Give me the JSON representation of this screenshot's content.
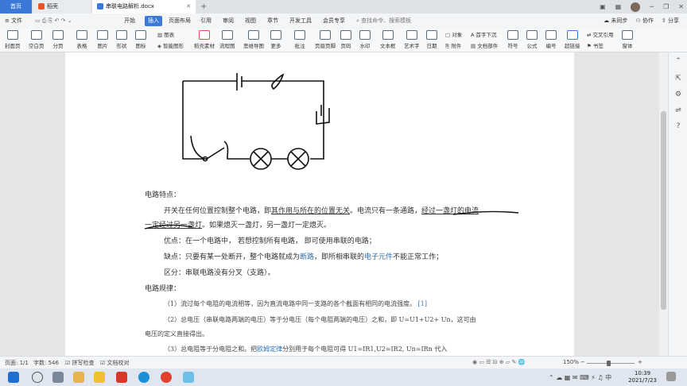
{
  "tabs": {
    "home": "首页",
    "daoke": "稻壳",
    "doc": "串联电路解析.docx",
    "add": "+"
  },
  "menu": {
    "file": "文件",
    "items": [
      "开始",
      "插入",
      "页面布局",
      "引用",
      "审阅",
      "视图",
      "章节",
      "开发工具",
      "会员专享"
    ],
    "search_placeholder": "查找命令、搜索模板",
    "right": [
      "未同步",
      "协作",
      "分享"
    ]
  },
  "ribbon": [
    {
      "label": "封面页",
      "icon": "cover-page-icon"
    },
    {
      "label": "空白页",
      "icon": "blank-page-icon"
    },
    {
      "label": "分页",
      "icon": "page-break-icon"
    },
    {
      "label": "表格",
      "icon": "table-icon"
    },
    {
      "label": "图片",
      "icon": "picture-icon"
    },
    {
      "label": "形状",
      "icon": "shape-icon"
    },
    {
      "label": "图标",
      "icon": "icons-icon"
    },
    {
      "label": "图表",
      "icon": "chart-icon"
    },
    {
      "label": "智能图形",
      "icon": "smartart-icon"
    },
    {
      "label": "稻壳素材",
      "icon": "material-icon"
    },
    {
      "label": "流程图",
      "icon": "flowchart-icon"
    },
    {
      "label": "思维导图",
      "icon": "mindmap-icon"
    },
    {
      "label": "更多",
      "icon": "more-icon"
    },
    {
      "label": "批注",
      "icon": "comment-icon"
    },
    {
      "label": "页眉页脚",
      "icon": "header-footer-icon"
    },
    {
      "label": "页码",
      "icon": "page-number-icon"
    },
    {
      "label": "水印",
      "icon": "watermark-icon"
    },
    {
      "label": "文本框",
      "icon": "textbox-icon"
    },
    {
      "label": "艺术字",
      "icon": "wordart-icon"
    },
    {
      "label": "日期",
      "icon": "date-icon"
    },
    {
      "label": "对象",
      "icon": "object-icon"
    },
    {
      "label": "附件",
      "icon": "attachment-icon"
    },
    {
      "label": "首字下沉",
      "icon": "dropcap-icon"
    },
    {
      "label": "文档部件",
      "icon": "doc-parts-icon"
    },
    {
      "label": "符号",
      "icon": "symbol-icon"
    },
    {
      "label": "公式",
      "icon": "formula-icon"
    },
    {
      "label": "编号",
      "icon": "numbering-icon"
    },
    {
      "label": "超链接",
      "icon": "hyperlink-icon"
    },
    {
      "label": "交叉引用",
      "icon": "cross-ref-icon"
    },
    {
      "label": "书签",
      "icon": "bookmark-icon"
    },
    {
      "label": "窗体",
      "icon": "form-icon"
    }
  ],
  "document": {
    "heading1": "电路特点：",
    "p1a_before": "开关在任何位置控制整个电路，即",
    "p1a_ul": "其作用与所在的位置无关",
    "p1a_after": "。电流只有一条通路，",
    "p1a_ul2": "经过一盏灯的电流",
    "p1b_ul": "一定经过另一盏灯",
    "p1b_after": "。如果熄灭一盏灯，另一盏灯一定熄灭。",
    "p2": "优点：在一个电路中， 若想控制所有电路， 即可使用串联的电路；",
    "p3_before": "缺点：只要有某一处断开，整个电路就成为",
    "p3_link1": "断路",
    "p3_mid": "，即所相串联的",
    "p3_link2": "电子元件",
    "p3_after": "不能正常工作；",
    "p4": "区分：串联电路没有分叉（支路）。",
    "heading2": "电路规律：",
    "r1": "（1）流过每个电阻的电流相等，因为直流电路中同一支路的各个截面有相同的电流强度。",
    "r1_ref": "[1]",
    "r2a": "（2）总电压（串联电路两端的电压）等于分电压（每个电阻两端的电压）之和，即 U=U1+U2+",
    "r2a_tail": "Un，这可由",
    "r2b": "电压的定义直接得出。",
    "r3_before": "（3）总电阻等于分电阻之和。把",
    "r3_link": "欧姆定律",
    "r3_after": "分别用于每个电阻可得 U1=IR1,U2=IR2,",
    "r3_tail": "Un=IRn 代入"
  },
  "status": {
    "page": "页面: 1/1",
    "words": "字数: 546",
    "spell": "拼写检查",
    "proof": "文档校对",
    "zoom": "150%"
  },
  "clock": {
    "time": "10:39",
    "date": "2021/7/23"
  },
  "colors": {
    "accent": "#3b79d9",
    "link": "#2f6fb3"
  }
}
